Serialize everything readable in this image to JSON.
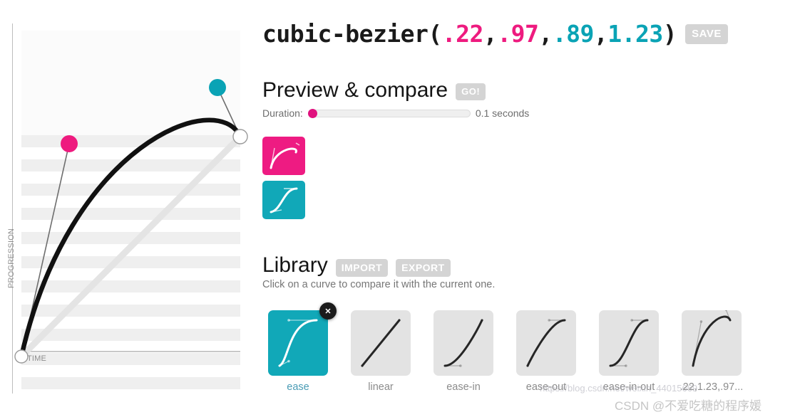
{
  "editor": {
    "axis_y_label": "PROGRESSION",
    "axis_x_label": "TIME",
    "curve": {
      "p1x": 0.22,
      "p1y": 0.97,
      "p2x": 0.89,
      "p2y": 1.23,
      "handle1_color": "#ee1b7f",
      "handle2_color": "#0aa3b5",
      "curve_color": "#111111",
      "linear_guide_color": "#e4e4e4"
    }
  },
  "title": {
    "fn_open": "cubic-bezier(",
    "p1": ".22",
    "comma1": ",",
    "p2": ".97",
    "comma2": ",",
    "p3": ".89",
    "comma3": ",",
    "p4": "1.23",
    "fn_close": ")",
    "save_label": "SAVE"
  },
  "preview": {
    "heading": "Preview & compare",
    "go_label": "GO!",
    "duration_label": "Duration:",
    "duration_value": "0.1 seconds",
    "duration_percent": 0,
    "swatch_current_color": "#ee1b82",
    "swatch_compare_color": "#11a8b8"
  },
  "library": {
    "heading": "Library",
    "import_label": "IMPORT",
    "export_label": "EXPORT",
    "hint": "Click on a curve to compare it with the current one.",
    "remove_badge": "✕",
    "items": [
      {
        "label": "ease",
        "selected": true,
        "p": [
          0.25,
          0.1,
          0.25,
          1.0
        ]
      },
      {
        "label": "linear",
        "selected": false,
        "p": [
          0.0,
          0.0,
          1.0,
          1.0
        ]
      },
      {
        "label": "ease-in",
        "selected": false,
        "p": [
          0.42,
          0.0,
          1.0,
          1.0
        ]
      },
      {
        "label": "ease-out",
        "selected": false,
        "p": [
          0.0,
          0.0,
          0.58,
          1.0
        ]
      },
      {
        "label": "ease-in-out",
        "selected": false,
        "p": [
          0.42,
          0.0,
          0.58,
          1.0
        ]
      },
      {
        "label": ".22,1.23,.97...",
        "selected": false,
        "p": [
          0.22,
          0.97,
          0.89,
          1.23
        ]
      }
    ]
  },
  "watermark": {
    "url": "https://blog.csdn.net/weixin_44015669",
    "csdn": "CSDN @不爱吃糖的程序媛"
  }
}
